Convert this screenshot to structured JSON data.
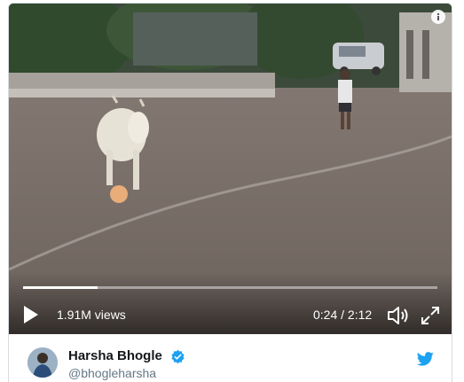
{
  "video": {
    "views": "1.91M views",
    "time": "0:24 / 2:12",
    "progress_fraction": 0.18,
    "scene_description_icon": "video-frame-cow-football"
  },
  "author": {
    "name": "Harsha Bhogle",
    "handle": "@bhogleharsha",
    "verified": true
  },
  "colors": {
    "verified_blue": "#1da1f2",
    "twitter_blue": "#1da1f2",
    "handle_gray": "#657786"
  },
  "icons": {
    "info": "info-icon",
    "play": "play-icon",
    "volume": "volume-icon",
    "fullscreen": "fullscreen-icon",
    "verified": "verified-badge-icon",
    "brand": "twitter-bird-icon"
  }
}
